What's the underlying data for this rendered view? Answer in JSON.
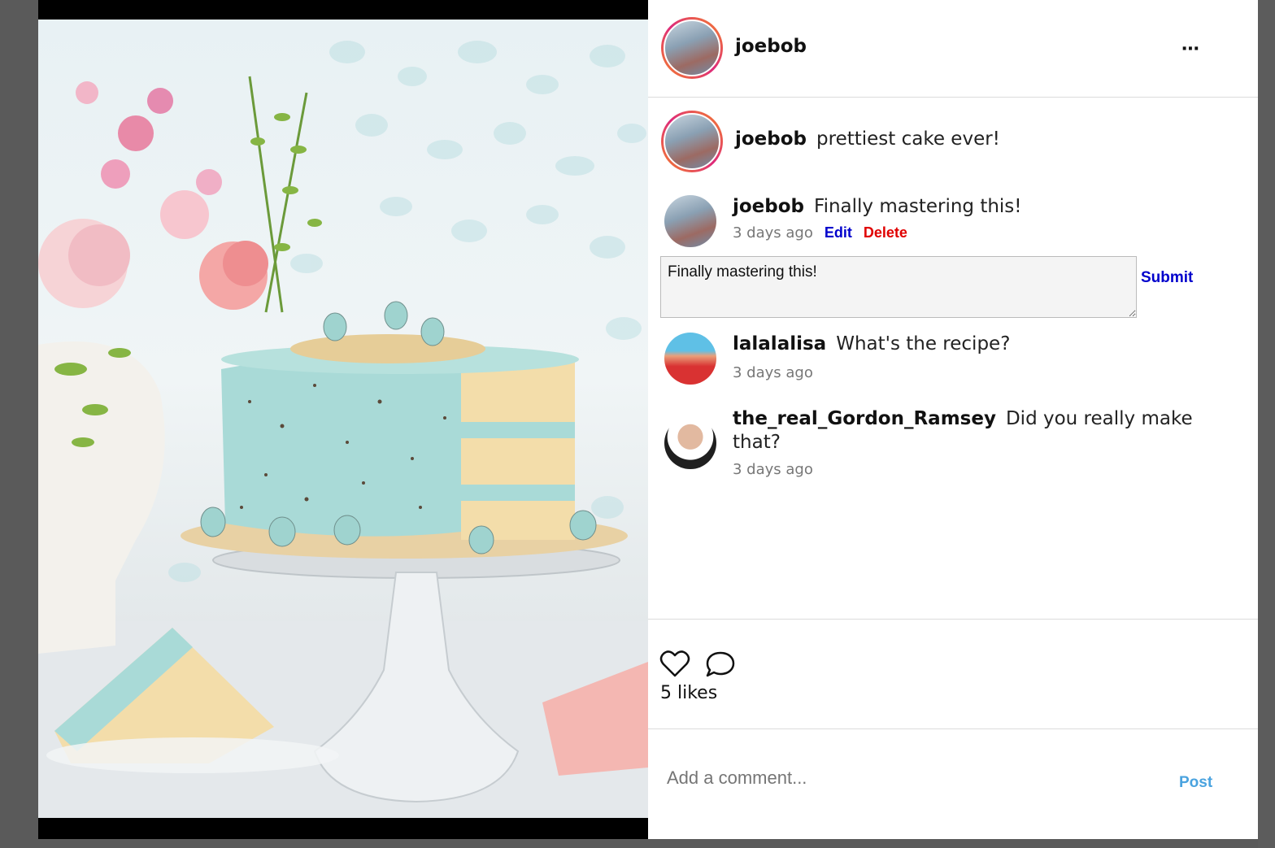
{
  "post": {
    "author": "joebob",
    "more_icon": "⋯",
    "caption_user": "joebob",
    "caption_text": "prettiest cake ever!"
  },
  "comments": [
    {
      "user": "joebob",
      "text": "Finally mastering this!",
      "time": "3 days ago",
      "edit_label": "Edit",
      "delete_label": "Delete"
    },
    {
      "user": "lalalalisa",
      "text": "What's the recipe?",
      "time": "3 days ago"
    },
    {
      "user": "the_real_Gordon_Ramsey",
      "text_line1": "Did you really make",
      "text_line2": "that?",
      "time": "3 days ago"
    }
  ],
  "edit": {
    "value": "Finally mastering this!",
    "submit_label": "Submit"
  },
  "actions": {
    "like_icon": "heart-icon",
    "comment_icon": "comment-bubble-icon",
    "likes_text": "5 likes"
  },
  "add_comment": {
    "placeholder": "Add a comment...",
    "post_label": "Post"
  },
  "colors": {
    "edit": "#0000cc",
    "delete": "#e00000",
    "post": "#4aa3df"
  }
}
